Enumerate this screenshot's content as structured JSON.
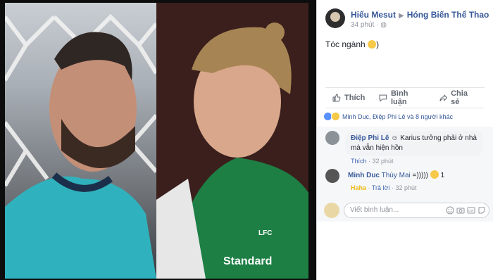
{
  "post": {
    "author": "Hiếu Mesut",
    "target": "Hóng Biến Thể Thao",
    "time": "34 phút",
    "text": "Tóc ngành"
  },
  "actions": {
    "like": "Thích",
    "comment": "Bình luận",
    "share": "Chia sẻ"
  },
  "reactions": {
    "summary": "Minh Duc, Điệp Phi Lê và 8 người khác"
  },
  "comments": [
    {
      "author": "Điệp Phi Lê",
      "text": "Karius tưởng phải ở nhà mà vẫn hiện hồn",
      "like": "Thích",
      "time": "32 phút"
    },
    {
      "author": "Minh Duc",
      "tag": "Thùy Mai",
      "text": "=)))))",
      "reaction_count": "1",
      "haha": "Haha",
      "reply": "Trả lời",
      "time": "32 phút"
    }
  ],
  "composer": {
    "placeholder": "Viết bình luận..."
  },
  "icons": [
    "globe-icon",
    "like-icon",
    "comment-icon",
    "share-icon",
    "emoji-icon",
    "camera-icon",
    "gif-icon",
    "sticker-icon"
  ]
}
